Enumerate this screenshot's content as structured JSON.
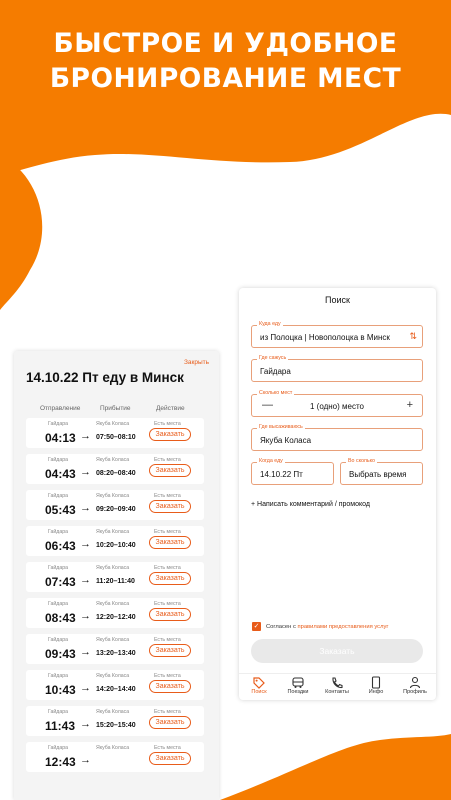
{
  "promo": {
    "line1": "БЫСТРОЕ И УДОБНОЕ",
    "line2": "БРОНИРОВАНИЕ МЕСТ"
  },
  "colors": {
    "accent": "#f57c00",
    "link": "#e85c1a",
    "submit_disabled": "#e9e9e9"
  },
  "schedule": {
    "close_link": "Закрыть",
    "title": "14.10.22 Пт еду в Минск",
    "columns": [
      "Отправление",
      "Прибытие",
      "Действие"
    ],
    "trips": [
      {
        "from": "Гайдара",
        "to": "Якуба Коласа",
        "availability": "Есть места",
        "departure": "04:13",
        "arrival": "07:50–08:10",
        "book": "Заказать"
      },
      {
        "from": "Гайдара",
        "to": "Якуба Коласа",
        "availability": "Есть места",
        "departure": "04:43",
        "arrival": "08:20–08:40",
        "book": "Заказать"
      },
      {
        "from": "Гайдара",
        "to": "Якуба Коласа",
        "availability": "Есть места",
        "departure": "05:43",
        "arrival": "09:20–09:40",
        "book": "Заказать"
      },
      {
        "from": "Гайдара",
        "to": "Якуба Коласа",
        "availability": "Есть места",
        "departure": "06:43",
        "arrival": "10:20–10:40",
        "book": "Заказать"
      },
      {
        "from": "Гайдара",
        "to": "Якуба Коласа",
        "availability": "Есть места",
        "departure": "07:43",
        "arrival": "11:20–11:40",
        "book": "Заказать"
      },
      {
        "from": "Гайдара",
        "to": "Якуба Коласа",
        "availability": "Есть места",
        "departure": "08:43",
        "arrival": "12:20–12:40",
        "book": "Заказать"
      },
      {
        "from": "Гайдара",
        "to": "Якуба Коласа",
        "availability": "Есть места",
        "departure": "09:43",
        "arrival": "13:20–13:40",
        "book": "Заказать"
      },
      {
        "from": "Гайдара",
        "to": "Якуба Коласа",
        "availability": "Есть места",
        "departure": "10:43",
        "arrival": "14:20–14:40",
        "book": "Заказать"
      },
      {
        "from": "Гайдара",
        "to": "Якуба Коласа",
        "availability": "Есть места",
        "departure": "11:43",
        "arrival": "15:20–15:40",
        "book": "Заказать"
      },
      {
        "from": "Гайдара",
        "to": "Якуба Коласа",
        "availability": "Есть места",
        "departure": "12:43",
        "arrival": "",
        "book": "Заказать"
      }
    ]
  },
  "search": {
    "title": "Поиск",
    "route_label": "Куда еду",
    "route_value": "из Полоцка | Новополоцка в Минск",
    "pickup_label": "Где сажусь",
    "pickup_value": "Гайдара",
    "seats_label": "Сколько мест",
    "seats_value": "1 (одно) место",
    "dropoff_label": "Где высаживаюсь",
    "dropoff_value": "Якуба Коласа",
    "date_label": "Когда еду",
    "date_value": "14.10.22 Пт",
    "time_label": "Во сколько",
    "time_value": "Выбрать время",
    "add_comment": "+ Написать комментарий / промокод",
    "agree_prefix": "Согласен с",
    "agree_link": "правилами предоставления услуг",
    "submit": "Заказать"
  },
  "tabs": [
    {
      "label": "Поиск",
      "icon": "tag-icon",
      "active": true
    },
    {
      "label": "Поездки",
      "icon": "bus-icon",
      "active": false
    },
    {
      "label": "Контакты",
      "icon": "phone-icon",
      "active": false
    },
    {
      "label": "Инфо",
      "icon": "document-icon",
      "active": false
    },
    {
      "label": "Профиль",
      "icon": "user-icon",
      "active": false
    }
  ]
}
